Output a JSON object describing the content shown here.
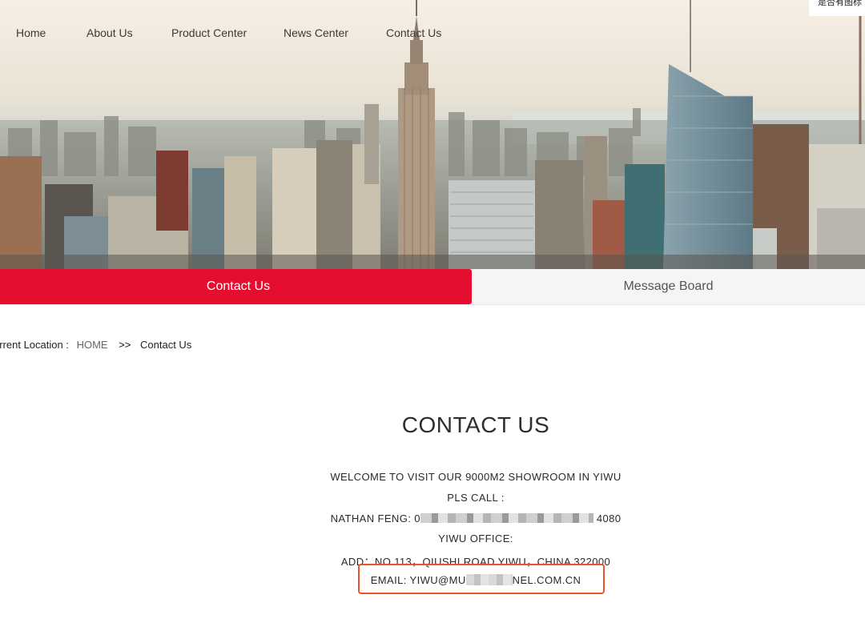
{
  "nav": {
    "items": [
      "Home",
      "About Us",
      "Product Center",
      "News Center",
      "Contact Us"
    ]
  },
  "corner_text": "是否有图标",
  "tabs": {
    "active": "Contact Us",
    "other": "Message Board"
  },
  "breadcrumb": {
    "label": "urrent Location :",
    "home": "HOME",
    "separator": ">>",
    "current": "Contact Us"
  },
  "contact": {
    "title": "CONTACT US",
    "welcome": "WELCOME TO VISIT OUR 9000M2 SHOWROOM IN YIWU",
    "call": "PLS CALL :",
    "phone_prefix": "NATHAN FENG: 0",
    "phone_suffix": "4080",
    "office": "YIWU OFFICE:",
    "address": "ADD：NO.113，QIUSHI ROAD YIWU，CHINA 322000",
    "email_prefix": "EMAIL: YIWU@MU",
    "email_suffix": "NEL.COM.CN"
  },
  "colors": {
    "accent": "#e60e2f",
    "highlight_box": "#e8542b"
  }
}
